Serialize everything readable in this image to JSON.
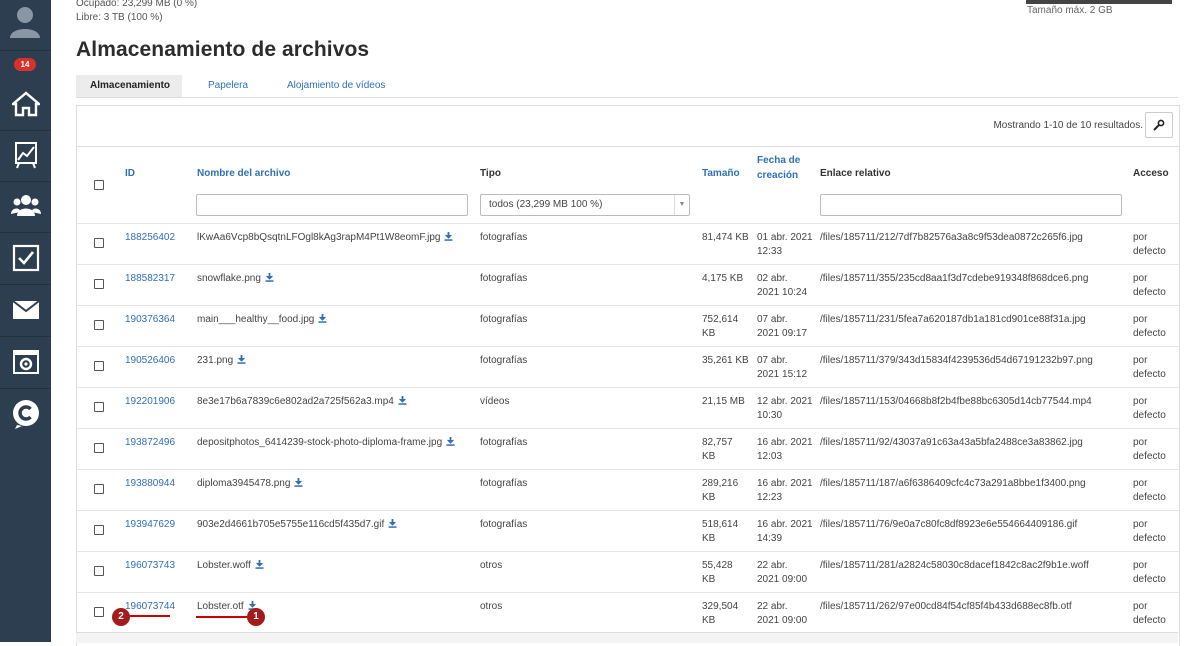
{
  "sidebar": {
    "badge": "14",
    "items": [
      {
        "icon": "home-icon"
      },
      {
        "icon": "chart-icon"
      },
      {
        "icon": "users-icon"
      },
      {
        "icon": "tasks-icon"
      },
      {
        "icon": "mail-icon"
      },
      {
        "icon": "settings-window-icon"
      },
      {
        "icon": "c-logo-icon"
      }
    ]
  },
  "storage_info": {
    "used": "Ocupado: 23,299 MB (0 %)",
    "free": "Libre: 3 TB (100 %)",
    "max_size": "Tamaño máx. 2 GB"
  },
  "page_title": "Almacenamiento de archivos",
  "tabs": [
    {
      "label": "Almacenamiento",
      "active": true
    },
    {
      "label": "Papelera",
      "active": false
    },
    {
      "label": "Alojamiento de vídeos",
      "active": false
    }
  ],
  "results_text": "Mostrando 1-10 de 10 resultados.",
  "columns": {
    "id": "ID",
    "name": "Nombre del archivo",
    "type": "Tipo",
    "size": "Tamaño",
    "date_line1": "Fecha de",
    "date_line2": "creación",
    "link": "Enlace relativo",
    "access": "Acceso"
  },
  "type_filter": "todos (23,299 MB 100 %)",
  "rows": [
    {
      "id": "188256402",
      "name": "lKwAa6Vcp8bQsqtnLFOgl8kAg3rapM4Pt1W8eomF.jpg",
      "type": "fotografías",
      "size1": "81,474 KB",
      "size2": "",
      "date1": "01 abr. 2021",
      "date2": "12:33",
      "link": "/files/185711/212/7df7b82576a3a8c9f53dea0872c265f6.jpg",
      "access1": "por",
      "access2": "defecto"
    },
    {
      "id": "188582317",
      "name": "snowflake.png",
      "type": "fotografías",
      "size1": "4,175 KB",
      "size2": "",
      "date1": "02 abr.",
      "date2": "2021 10:24",
      "link": "/files/185711/355/235cd8aa1f3d7cdebe919348f868dce6.png",
      "access1": "por",
      "access2": "defecto"
    },
    {
      "id": "190376364",
      "name": "main___healthy__food.jpg",
      "type": "fotografías",
      "size1": "752,614",
      "size2": "KB",
      "date1": "07 abr.",
      "date2": "2021 09:17",
      "link": "/files/185711/231/5fea7a620187db1a181cd901ce88f31a.jpg",
      "access1": "por",
      "access2": "defecto"
    },
    {
      "id": "190526406",
      "name": "231.png",
      "type": "fotografías",
      "size1": "35,261 KB",
      "size2": "",
      "date1": "07 abr.",
      "date2": "2021 15:12",
      "link": "/files/185711/379/343d15834f4239536d54d67191232b97.png",
      "access1": "por",
      "access2": "defecto"
    },
    {
      "id": "192201906",
      "name": "8e3e17b6a7839c6e802ad2a725f562a3.mp4",
      "type": "vídeos",
      "size1": "21,15 MB",
      "size2": "",
      "date1": "12 abr. 2021",
      "date2": "10:30",
      "link": "/files/185711/153/04668b8f2b4fbe88bc6305d14cb77544.mp4",
      "access1": "por",
      "access2": "defecto"
    },
    {
      "id": "193872496",
      "name": "depositphotos_6414239-stock-photo-diploma-frame.jpg",
      "type": "fotografías",
      "size1": "82,757",
      "size2": "KB",
      "date1": "16 abr. 2021",
      "date2": "12:03",
      "link": "/files/185711/92/43037a91c63a43a5bfa2488ce3a83862.jpg",
      "access1": "por",
      "access2": "defecto"
    },
    {
      "id": "193880944",
      "name": "diploma3945478.png",
      "type": "fotografías",
      "size1": "289,216",
      "size2": "KB",
      "date1": "16 abr. 2021",
      "date2": "12:23",
      "link": "/files/185711/187/a6f6386409cfc4c73a291a8bbe1f3400.png",
      "access1": "por",
      "access2": "defecto"
    },
    {
      "id": "193947629",
      "name": "903e2d4661b705e5755e116cd5f435d7.gif",
      "type": "fotografías",
      "size1": "518,614",
      "size2": "KB",
      "date1": "16 abr. 2021",
      "date2": "14:39",
      "link": "/files/185711/76/9e0a7c80fc8df8923e6e554664409186.gif",
      "access1": "por",
      "access2": "defecto"
    },
    {
      "id": "196073743",
      "name": "Lobster.woff",
      "type": "otros",
      "size1": "55,428",
      "size2": "KB",
      "date1": "22 abr.",
      "date2": "2021 09:00",
      "link": "/files/185711/281/a2824c58030c8dacef1842c8ac2f9b1e.woff",
      "access1": "por",
      "access2": "defecto"
    },
    {
      "id": "196073744",
      "name": "Lobster.otf",
      "type": "otros",
      "size1": "329,504",
      "size2": "KB",
      "date1": "22 abr.",
      "date2": "2021 09:00",
      "link": "/files/185711/262/97e00cd84f54cf85f4b433d688ec8fb.otf",
      "access1": "por",
      "access2": "defecto"
    }
  ],
  "annotations": [
    {
      "label": "1"
    },
    {
      "label": "2"
    }
  ],
  "colors": {
    "sidebar": "#2d3e50",
    "link": "#2f6fb7",
    "badge": "#d9322a",
    "annotation": "#a51b1b"
  }
}
